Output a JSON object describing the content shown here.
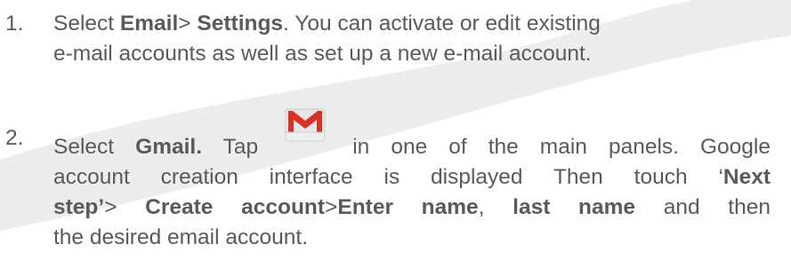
{
  "step1": {
    "number": "1.",
    "prefix": "Select ",
    "email": "Email",
    "sep": "> ",
    "settings": "Settings",
    "rest_line1": ". You can activate or edit existing",
    "line2": "e-mail accounts as well as set up a new e-mail account."
  },
  "step2": {
    "number": "2.",
    "prefix": "Select ",
    "gmail": "Gmail.",
    "tap": " Tap ",
    "after_icon": " in one of the main panels. Google",
    "line2": "account creation interface is displayed Then touch ‘",
    "next_step": "Next",
    "line3_start": "step’",
    "sep1": "> ",
    "create_account": "Create account",
    "sep2": ">",
    "enter_name": "Enter name",
    "comma": ", ",
    "last_name": "last name",
    "line3_end": " and then",
    "line4": "the desired email account."
  },
  "icons": {
    "gmail": "gmail-icon"
  },
  "colors": {
    "text": "#5a5a5a",
    "gmail_red": "#d93025",
    "swoosh": "#ececec"
  }
}
